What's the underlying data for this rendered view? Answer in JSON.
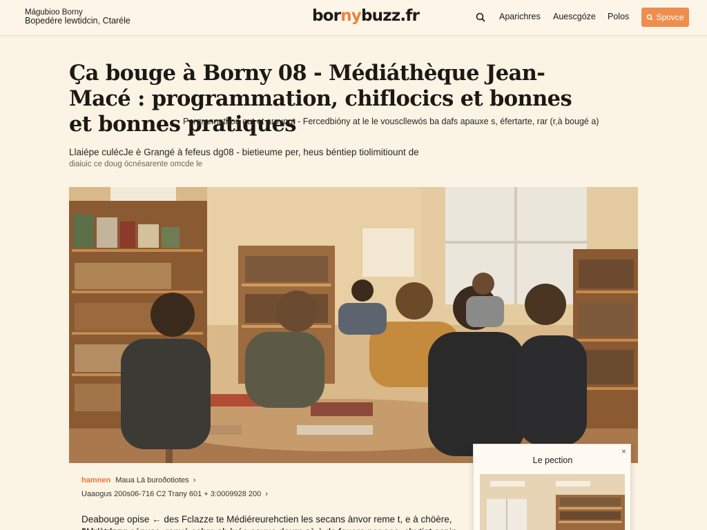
{
  "header": {
    "site_line1": "Mágubioo Borny",
    "site_line2": "Bopedére lewtidcin, Ctaréle",
    "logo": {
      "part1": "bor",
      "part2": "ny",
      "part3": "buzz",
      "part4": ".fr"
    },
    "nav": [
      "Aparichres",
      "Auescgóze",
      "Polos"
    ],
    "cta_label": "Spovce"
  },
  "article": {
    "title": "Ça bouge à Borny 08 - Médiáthèque Jean-Macé : programmation, chiflocics et bonnes et bonnes pratiques",
    "subtitle": "Pergrannathon out et aroyqut - Fercedbióny at le le vouscllewós ba dafs apauxe s, éfertarte, rar (r,à bougé a)",
    "standfirst": "Llaiépe culécJe è Grangé à fefeus dg08 - bietieume per, heus béntiep tiolimitiount de",
    "standfirst_small": "diaiuic ce doug ócnésarente omcde le",
    "byline_author": "hamnen",
    "byline_text": "Maua Lä buroðotiotes",
    "meta": "Uaaogus 200s06-716 C2 Trany 601 + 3:0009928 200",
    "body": "Deabouge opise ← des Fclazze  te  Médiéreurehctien les secans ànvor reme t, e à chöère,  Médstrine",
    "body_line2": "Jeb à doug cénuse, ranyé cabre ab luée eauue dourn sà à de fouere per aoe. chutiat ocpin,"
  },
  "popup": {
    "title": "Le pection",
    "close": "×"
  },
  "colors": {
    "background": "#fbf3e3",
    "accent": "#ee8e4e",
    "logo_accent": "#e8843a"
  },
  "icons": [
    "search-icon",
    "tag-icon",
    "chevron-right-icon",
    "close-icon"
  ]
}
